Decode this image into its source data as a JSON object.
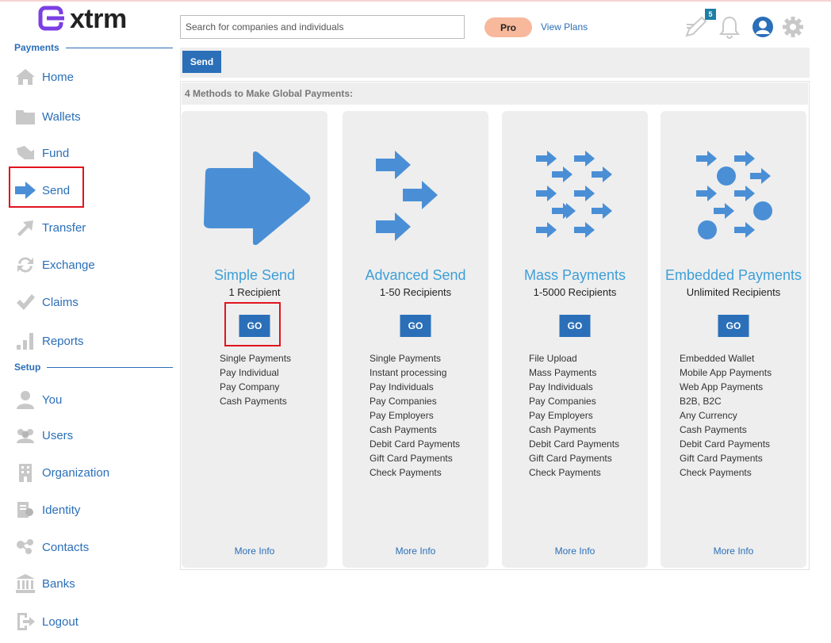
{
  "app": {
    "logo_text": "xtrm"
  },
  "sidebar": {
    "payments_title": "Payments",
    "setup_title": "Setup",
    "payments_items": [
      {
        "label": "Home",
        "icon": "home-icon"
      },
      {
        "label": "Wallets",
        "icon": "folder-icon"
      },
      {
        "label": "Fund",
        "icon": "fund-icon"
      },
      {
        "label": "Send",
        "icon": "arrow-right-icon"
      },
      {
        "label": "Transfer",
        "icon": "transfer-icon"
      },
      {
        "label": "Exchange",
        "icon": "exchange-icon"
      },
      {
        "label": "Claims",
        "icon": "checkmark-icon"
      },
      {
        "label": "Reports",
        "icon": "bar-chart-icon"
      }
    ],
    "setup_items": [
      {
        "label": "You",
        "icon": "user-icon"
      },
      {
        "label": "Users",
        "icon": "users-icon"
      },
      {
        "label": "Organization",
        "icon": "building-icon"
      },
      {
        "label": "Identity",
        "icon": "identity-icon"
      },
      {
        "label": "Contacts",
        "icon": "contacts-icon"
      },
      {
        "label": "Banks",
        "icon": "bank-icon"
      },
      {
        "label": "Logout",
        "icon": "logout-icon"
      }
    ]
  },
  "header": {
    "search_placeholder": "Search for companies and individuals",
    "plan_badge": "Pro",
    "view_plans": "View Plans",
    "notes_count": "5"
  },
  "main": {
    "active_tab": "Send",
    "methods_heading": "4 Methods to Make Global Payments:",
    "go_label": "GO",
    "more_info_label": "More Info",
    "cards": [
      {
        "title": "Simple Send",
        "subtitle": "1 Recipient",
        "features": [
          "Single Payments",
          "Pay Individual",
          "Pay Company",
          "Cash Payments"
        ]
      },
      {
        "title": "Advanced Send",
        "subtitle": "1-50 Recipients",
        "features": [
          "Single Payments",
          "Instant processing",
          "Pay Individuals",
          "Pay Companies",
          "Pay Employers",
          "Cash Payments",
          "Debit Card Payments",
          "Gift Card Payments",
          "Check Payments"
        ]
      },
      {
        "title": "Mass Payments",
        "subtitle": "1-5000 Recipients",
        "features": [
          "File Upload",
          "Mass Payments",
          "Pay Individuals",
          "Pay Companies",
          "Pay Employers",
          "Cash Payments",
          "Debit Card Payments",
          "Gift Card Payments",
          "Check Payments"
        ]
      },
      {
        "title": "Embedded Payments",
        "subtitle": "Unlimited Recipients",
        "features": [
          "Embedded Wallet",
          "Mobile App Payments",
          "Web App Payments",
          "B2B, B2C",
          "Any Currency",
          "Cash Payments",
          "Debit Card Payments",
          "Gift Card Payments",
          "Check Payments"
        ]
      }
    ]
  },
  "colors": {
    "brand_blue": "#2a6fb8",
    "icon_blue": "#4a8fd6",
    "logo_purple": "#7b3fe4",
    "pro_badge": "#f8b89b",
    "highlight_red": "#e0141e"
  }
}
